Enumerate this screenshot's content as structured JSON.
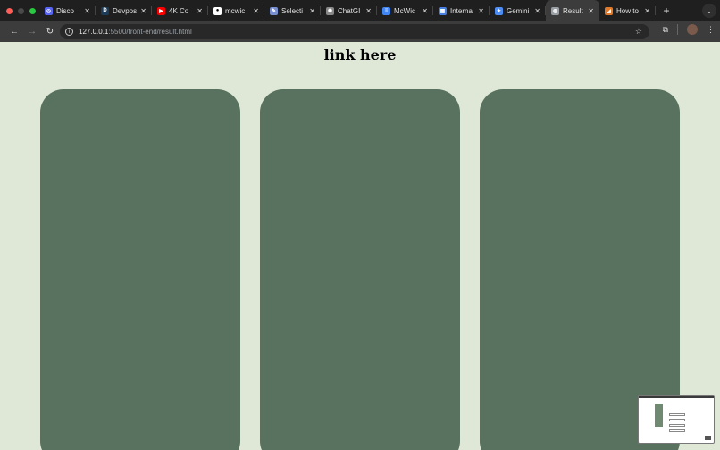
{
  "tabs": [
    {
      "title": "Disco",
      "icon": "discord-icon",
      "color": "#5865f2",
      "glyph": "◎"
    },
    {
      "title": "Devpos",
      "icon": "devpost-icon",
      "color": "#1d3b57",
      "glyph": "D"
    },
    {
      "title": "4K Co",
      "icon": "youtube-icon",
      "color": "#ff0000",
      "glyph": "▶"
    },
    {
      "title": "mcwic",
      "icon": "github-icon",
      "color": "#ffffff",
      "glyph": "●"
    },
    {
      "title": "Selecti",
      "icon": "selection-icon",
      "color": "#7a8fcf",
      "glyph": "✎"
    },
    {
      "title": "ChatGI",
      "icon": "chatgpt-icon",
      "color": "#888888",
      "glyph": "✺"
    },
    {
      "title": "McWic",
      "icon": "docs-icon",
      "color": "#4285f4",
      "glyph": "≡"
    },
    {
      "title": "Interna",
      "icon": "calendar-icon",
      "color": "#4a7fe0",
      "glyph": "▦"
    },
    {
      "title": "Gemini",
      "icon": "gemini-icon",
      "color": "#4c8df6",
      "glyph": "✦"
    },
    {
      "title": "Result",
      "icon": "globe-icon",
      "color": "#9aa0a6",
      "glyph": "◍",
      "active": true
    },
    {
      "title": "How to",
      "icon": "howto-icon",
      "color": "#e07a2a",
      "glyph": "◢"
    }
  ],
  "toolbar": {
    "url_host": "127.0.0.1",
    "url_path": ":5500/front-end/result.html"
  },
  "page": {
    "title": "link here"
  },
  "colors": {
    "page_bg": "#dfe8d7",
    "card_bg": "#58725f"
  }
}
